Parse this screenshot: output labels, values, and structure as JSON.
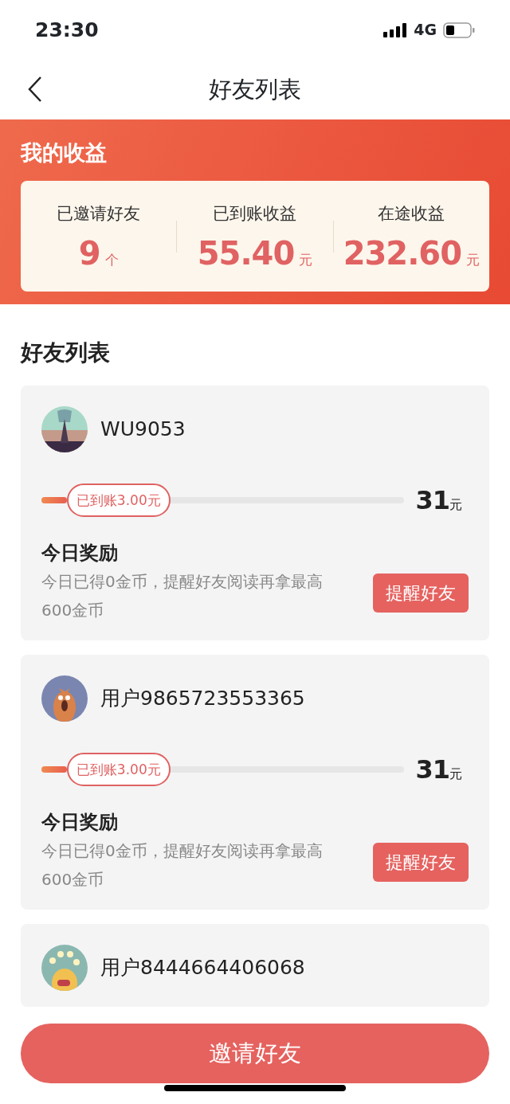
{
  "status_bar": {
    "time": "23:30",
    "network": "4G"
  },
  "nav": {
    "title": "好友列表"
  },
  "earnings": {
    "title": "我的收益",
    "stats": [
      {
        "label": "已邀请好友",
        "value": "9",
        "unit": "个"
      },
      {
        "label": "已到账收益",
        "value": "55.40",
        "unit": "元"
      },
      {
        "label": "在途收益",
        "value": "232.60",
        "unit": "元"
      }
    ]
  },
  "section_title": "好友列表",
  "friends": [
    {
      "name": "WU9053",
      "progress": {
        "level": 0.07,
        "badge": "已到账3.00元"
      },
      "target_value": "31",
      "target_unit": "元",
      "reward_title": "今日奖励",
      "reward_text": "今日已得0金币，提醒好友阅读再拿最高600金币",
      "button": "提醒好友"
    },
    {
      "name": "用户9865723553365",
      "progress": {
        "level": 0.07,
        "badge": "已到账3.00元"
      },
      "target_value": "31",
      "target_unit": "元",
      "reward_title": "今日奖励",
      "reward_text": "今日已得0金币，提醒好友阅读再拿最高600金币",
      "button": "提醒好友"
    },
    {
      "name": "用户8444664406068"
    }
  ],
  "invite_button": "邀请好友"
}
